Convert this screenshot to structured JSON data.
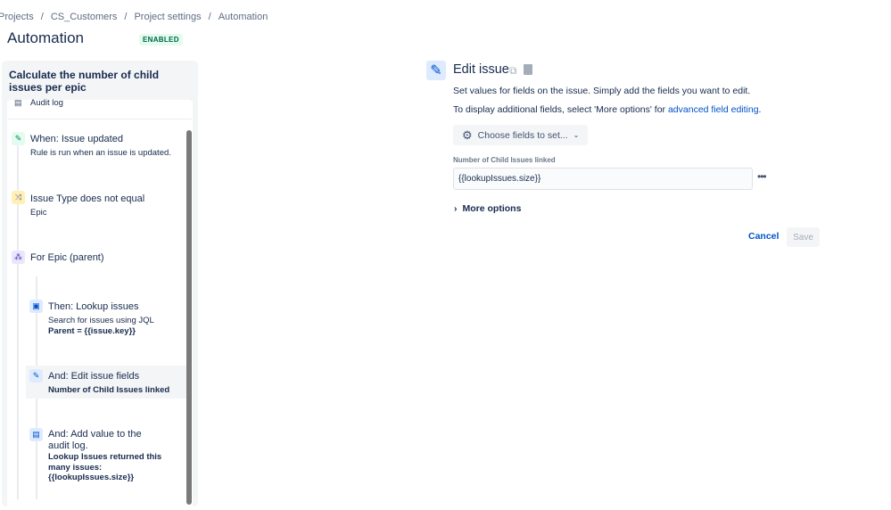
{
  "breadcrumb": [
    "Projects",
    "CS_Customers",
    "Project settings",
    "Automation"
  ],
  "page_title": "Automation",
  "status_badge": "ENABLED",
  "rule": {
    "title": "Calculate the number of child issues per epic",
    "audit_log": "Audit log",
    "steps": [
      {
        "title": "When: Issue updated",
        "desc": "Rule is run when an issue is updated.",
        "icon": "pencil-icon"
      },
      {
        "title": "Issue Type does not equal",
        "desc": "Epic",
        "icon": "shuffle-icon"
      },
      {
        "title": "For Epic (parent)",
        "icon": "hierarchy-icon"
      },
      {
        "title": "Then: Lookup issues",
        "desc": "Search for issues using JQL",
        "bold": "Parent = {{issue.key}}",
        "icon": "lookup-icon"
      },
      {
        "title": "And: Edit issue fields",
        "bold": "Number of Child Issues linked",
        "icon": "pencil-icon"
      },
      {
        "title": "And: Add value to the audit log.",
        "bold": "Lookup Issues returned this many issues: {{lookupIssues.size}}",
        "icon": "document-icon"
      }
    ]
  },
  "editor": {
    "title": "Edit issue",
    "desc1": "Set values for fields on the issue. Simply add the fields you want to edit.",
    "desc2_prefix": "To display additional fields, select 'More options' for ",
    "desc2_link": "advanced field editing",
    "desc2_suffix": ".",
    "choose_fields": "Choose fields to set...",
    "field_label": "Number of Child Issues linked",
    "field_value": "{{lookupIssues.size}}",
    "more_options": "More options",
    "cancel": "Cancel",
    "save": "Save"
  }
}
